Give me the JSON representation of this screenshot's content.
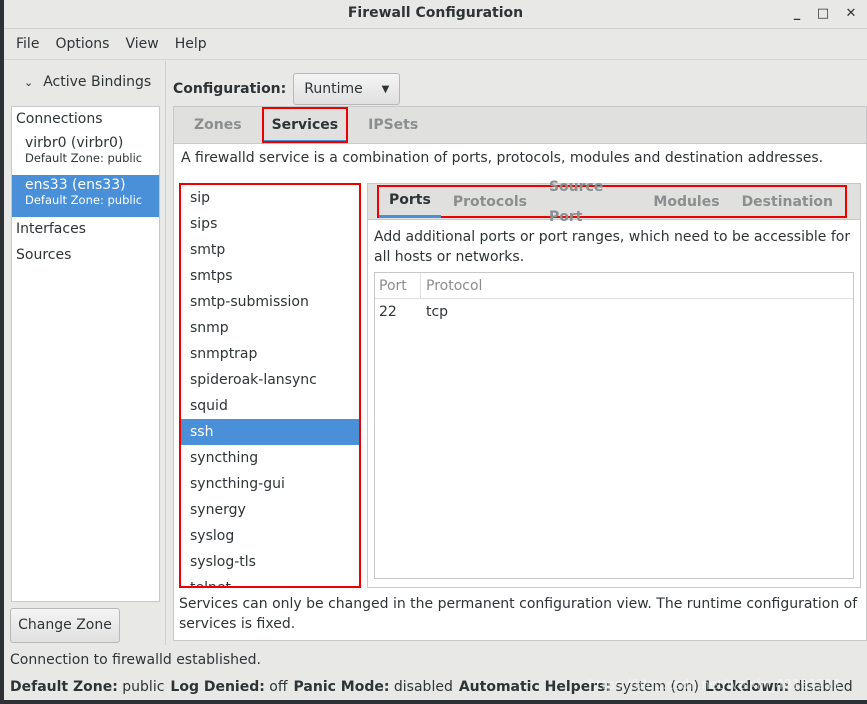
{
  "window": {
    "title": "Firewall Configuration",
    "minimize": "_",
    "maximize": "□",
    "close": "✕"
  },
  "menu": [
    "File",
    "Options",
    "View",
    "Help"
  ],
  "left": {
    "active_bindings": "Active Bindings",
    "connections_header": "Connections",
    "connections": [
      {
        "name": "virbr0 (virbr0)",
        "zone": "Default Zone: public"
      },
      {
        "name": "ens33 (ens33)",
        "zone": "Default Zone: public"
      }
    ],
    "interfaces": "Interfaces",
    "sources": "Sources",
    "change_zone": "Change Zone"
  },
  "config": {
    "label": "Configuration:",
    "value": "Runtime"
  },
  "tabs": [
    "Zones",
    "Services",
    "IPSets"
  ],
  "services_description": "A firewalld service is a combination of ports, protocols, modules and destination addresses.",
  "services": [
    "sip",
    "sips",
    "smtp",
    "smtps",
    "smtp-submission",
    "snmp",
    "snmptrap",
    "spideroak-lansync",
    "squid",
    "ssh",
    "syncthing",
    "syncthing-gui",
    "synergy",
    "syslog",
    "syslog-tls",
    "telnet"
  ],
  "selected_service": "ssh",
  "subtabs": [
    "Ports",
    "Protocols",
    "Source Port",
    "Modules",
    "Destination"
  ],
  "ports": {
    "description": "Add additional ports or port ranges, which need to be accessible for all hosts or networks.",
    "columns": [
      "Port",
      "Protocol"
    ],
    "rows": [
      [
        "22",
        "tcp"
      ]
    ]
  },
  "footer_note": "Services can only be changed in the permanent configuration view. The runtime configuration of services is fixed.",
  "status": "Connection to firewalld established.",
  "info": [
    {
      "k": "Default Zone:",
      "v": "public"
    },
    {
      "k": "Log Denied:",
      "v": "off"
    },
    {
      "k": "Panic Mode:",
      "v": "disabled"
    },
    {
      "k": "Automatic Helpers:",
      "v": "system (on)"
    },
    {
      "k": "Lockdown:",
      "v": "disabled"
    }
  ],
  "watermark": "https://blog.csdn.net/weixin_48191211"
}
